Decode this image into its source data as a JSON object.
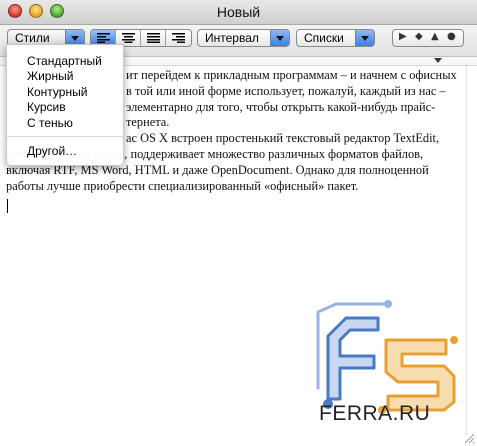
{
  "window": {
    "title": "Новый"
  },
  "toolbar": {
    "styles_label": "Стили",
    "interval_label": "Интервал",
    "lists_label": "Списки",
    "align_buttons": [
      "align-left",
      "align-center",
      "align-justify",
      "align-right"
    ],
    "active_align": "align-left",
    "nav_glyphs": [
      "▶",
      "◆",
      "▲",
      "●"
    ]
  },
  "styles_menu": {
    "items": [
      "Стандартный",
      "Жирный",
      "Контурный",
      "Курсив",
      "С тенью"
    ],
    "other": "Другой…"
  },
  "document": {
    "lines": [
      "ит перейдем к прикладным программам – и начнем с офисных",
      "в той или иной форме использует, пожалуй, каждый из нас –",
      "элементарно для того, чтобы открыть какой-нибудь прайс-",
      "тернета.",
      "ас OS X встроен простенький текстовый редактор TextEdit,",
      "который, тем не менее, поддерживает множество различных форматов файлов,",
      "включая RTF, MS Word, HTML и даже OpenDocument. Однако для полноценной",
      "работы лучше приобрести специализированный «офисный» пакет."
    ]
  },
  "logo": {
    "text": "FERRA.RU"
  },
  "colors": {
    "accent_blue": "#3d7ddf",
    "logo_blue": "#4a78c8",
    "logo_orange": "#e8a030"
  }
}
